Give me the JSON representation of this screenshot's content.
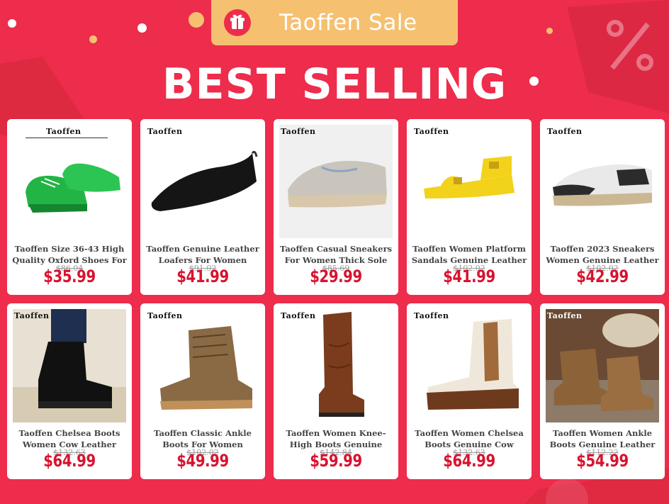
{
  "banner": {
    "sale_label": "Taoffen  Sale",
    "headline": "BEST SELLING",
    "icons": [
      "gift-icon",
      "percent-icon",
      "shopping-bag-icon"
    ],
    "colors": {
      "background": "#ee2c4c",
      "pill": "#f5c170",
      "price": "#d8132e"
    }
  },
  "products": [
    {
      "brand": "Taoffen",
      "title": "Taoffen Size 36-43 High Quality Oxford Shoes For",
      "old_price": "$86.04",
      "price": "$35.99",
      "shoe_color": "#22b445"
    },
    {
      "brand": "Taoffen",
      "title": "Taoffen Genuine Leather Loafers For Women Sheep",
      "old_price": "$91.02",
      "price": "$41.99",
      "shoe_color": "#151515"
    },
    {
      "brand": "Taoffen",
      "title": "Taoffen Casual Sneakers For Women Thick Sole",
      "old_price": "$85.69",
      "price": "$29.99",
      "shoe_color": "#c9c4bc"
    },
    {
      "brand": "Taoffen",
      "title": "Taoffen Women Platform Sandals Genuine Leather",
      "old_price": "$102.02",
      "price": "$41.99",
      "shoe_color": "#f2d21a"
    },
    {
      "brand": "Taoffen",
      "title": "Taoffen 2023 Sneakers Women Genuine Leather",
      "old_price": "$102.02",
      "price": "$42.99",
      "shoe_color": "#2b2b2b"
    },
    {
      "brand": "Taoffen",
      "title": "Taoffen Chelsea Boots Women Cow Leather",
      "old_price": "$132.63",
      "price": "$64.99",
      "shoe_color": "#111111"
    },
    {
      "brand": "Taoffen",
      "title": "Taoffen Classic Ankle Boots For Women Genuine",
      "old_price": "$102.02",
      "price": "$49.99",
      "shoe_color": "#8a6a44"
    },
    {
      "brand": "Taoffen",
      "title": "Taoffen Women Knee-High Boots Genuine Leather",
      "old_price": "$142.84",
      "price": "$59.99",
      "shoe_color": "#7a3c1c"
    },
    {
      "brand": "Taoffen",
      "title": "Taoffen Women Chelsea Boots Genuine Cow Leatehr",
      "old_price": "$132.63",
      "price": "$64.99",
      "shoe_color": "#efe8da"
    },
    {
      "brand": "Taoffen",
      "title": "Taoffen Women Ankle Boots Genuine Leather",
      "old_price": "$112.22",
      "price": "$54.99",
      "shoe_color": "#8c6338"
    }
  ]
}
